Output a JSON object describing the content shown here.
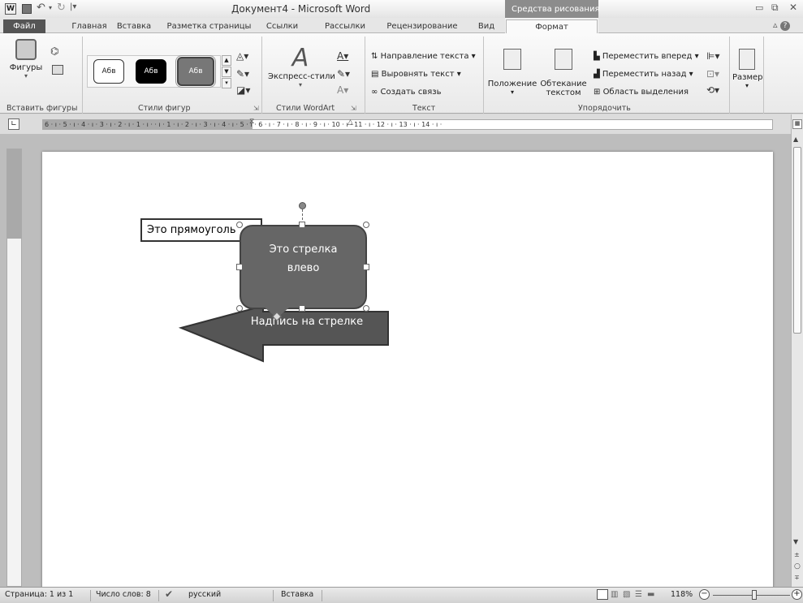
{
  "window": {
    "title": "Документ4 - Microsoft Word",
    "context_tab_title": "Средства рисования"
  },
  "tabs": [
    {
      "label": "Файл"
    },
    {
      "label": "Главная"
    },
    {
      "label": "Вставка"
    },
    {
      "label": "Разметка страницы"
    },
    {
      "label": "Ссылки"
    },
    {
      "label": "Рассылки"
    },
    {
      "label": "Рецензирование"
    },
    {
      "label": "Вид"
    },
    {
      "label": "Формат"
    }
  ],
  "ribbon": {
    "insert_shapes": {
      "shapes_label": "Фигуры",
      "group_label": "Вставить фигуры"
    },
    "shape_styles": {
      "style1": "Абв",
      "style2": "Абв",
      "style3": "Абв",
      "group_label": "Стили фигур"
    },
    "wordart": {
      "express_label": "Экспресс-стили",
      "group_label": "Стили WordArt"
    },
    "text": {
      "direction": "Направление текста",
      "align": "Выровнять текст",
      "link": "Создать связь",
      "group_label": "Текст"
    },
    "arrange": {
      "position": "Положение",
      "wrap1": "Обтекание",
      "wrap2": "текстом",
      "forward": "Переместить вперед",
      "backward": "Переместить назад",
      "selection_pane": "Область выделения",
      "group_label": "Упорядочить"
    },
    "size": {
      "label": "Размер"
    }
  },
  "ruler": {
    "ticks": "6 · ı · 5 · ı · 4 · ı · 3 · ı · 2 · ı · 1 · ı ·   · ı · 1 · ı · 2 · ı · 3 · ı · 4 · ı · 5 · ı · 6 · ı · 7 · ı · 8 · ı · 9 · ı · 10 · ı · 11 · ı · 12 · ı · 13 · ı · 14 · ı ·"
  },
  "document": {
    "rectangle_text": "Это прямоуголь",
    "callout_line1": "Это стрелка",
    "callout_line2": "влево",
    "arrow_text": "Надпись на стрелке"
  },
  "status": {
    "page": "Страница: 1 из 1",
    "words": "Число слов: 8",
    "language": "русский",
    "mode": "Вставка",
    "zoom": "118%"
  }
}
